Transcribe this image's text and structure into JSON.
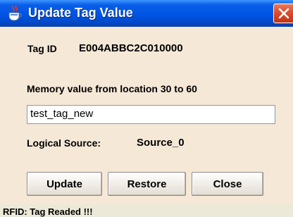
{
  "window": {
    "title": "Update Tag Value",
    "icon": "java-cup-icon",
    "close_icon": "close-icon"
  },
  "form": {
    "tag_id_label": "Tag ID",
    "tag_id_value": "E004ABBC2C010000",
    "memory_label": "Memory value from location 30 to 60",
    "memory_value": "test_tag_new",
    "logical_source_label": "Logical Source:",
    "logical_source_value": "Source_0"
  },
  "buttons": {
    "update": "Update",
    "restore": "Restore",
    "close": "Close"
  },
  "status": {
    "text": "RFID: Tag Readed !!!"
  },
  "colors": {
    "titlebar": "#0054e3",
    "dialog_bg": "#f5e8d7",
    "close_button": "#d94a2a"
  }
}
